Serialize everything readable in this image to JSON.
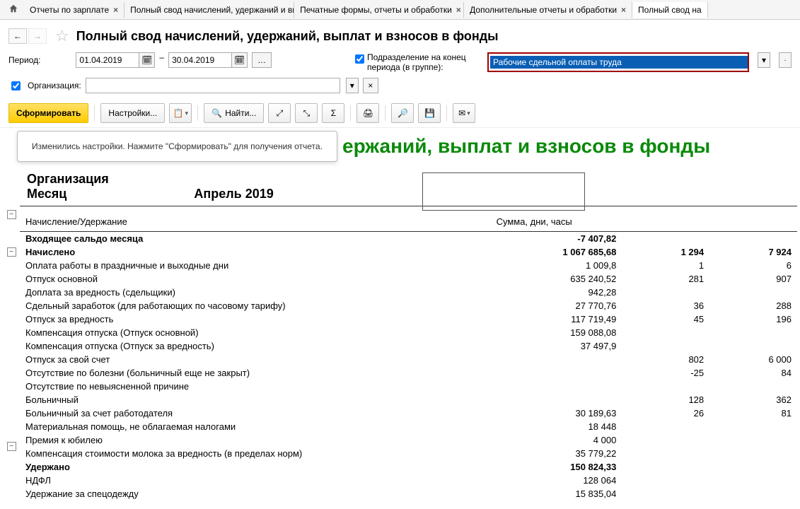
{
  "tabs": [
    {
      "label": "Отчеты по зарплате"
    },
    {
      "label": "Полный свод начислений, удержаний и выплат"
    },
    {
      "label": "Печатные формы, отчеты и обработки"
    },
    {
      "label": "Дополнительные отчеты и обработки"
    },
    {
      "label": "Полный свод на"
    }
  ],
  "page_title": "Полный свод начислений, удержаний, выплат и взносов в фонды",
  "period": {
    "label": "Период:",
    "from": "01.04.2019",
    "to": "30.04.2019"
  },
  "subdivision": {
    "checkbox_label": "Подразделение на конец периода (в группе):",
    "value": "Рабочие сдельной оплаты труда"
  },
  "org": {
    "checkbox_label": "Организация:",
    "value": ""
  },
  "toolbar": {
    "generate": "Сформировать",
    "settings": "Настройки...",
    "find": "Найти..."
  },
  "tooltip": "Изменились настройки. Нажмите \"Сформировать\" для получения отчета.",
  "report": {
    "title_suffix": "ержаний, выплат и взносов в фонды",
    "header": {
      "org_label": "Организация",
      "month_label": "Месяц",
      "month_value": "Апрель 2019"
    },
    "columns": {
      "name": "Начисление/Удержание",
      "sum": "Сумма, дни, часы"
    },
    "rows": [
      {
        "name": "Входящее сальдо месяца",
        "c1": "-7 407,82",
        "bold": true
      },
      {
        "name": "Начислено",
        "c1": "1 067 685,68",
        "c2": "1 294",
        "c3": "7 924",
        "bold": true
      },
      {
        "name": "Оплата работы в праздничные и выходные дни",
        "c1": "1 009,8",
        "c2": "1",
        "c3": "6"
      },
      {
        "name": "Отпуск основной",
        "c1": "635 240,52",
        "c2": "281",
        "c3": "907"
      },
      {
        "name": "Доплата за вредность (сдельщики)",
        "c1": "942,28"
      },
      {
        "name": "Сдельный заработок (для работающих по часовому тарифу)",
        "c1": "27 770,76",
        "c2": "36",
        "c3": "288"
      },
      {
        "name": "Отпуск за вредность",
        "c1": "117 719,49",
        "c2": "45",
        "c3": "196"
      },
      {
        "name": "Компенсация отпуска (Отпуск основной)",
        "c1": "159 088,08"
      },
      {
        "name": "Компенсация отпуска (Отпуск за вредность)",
        "c1": "37 497,9"
      },
      {
        "name": "Отпуск за свой счет",
        "c2": "802",
        "c3": "6 000"
      },
      {
        "name": "Отсутствие по болезни (больничный еще не закрыт)",
        "c2": "-25",
        "c3": "84"
      },
      {
        "name": "Отсутствие по невыясненной причине"
      },
      {
        "name": "Больничный",
        "c2": "128",
        "c3": "362"
      },
      {
        "name": "Больничный за счет работодателя",
        "c1": "30 189,63",
        "c2": "26",
        "c3": "81"
      },
      {
        "name": "Материальная помощь, не облагаемая налогами",
        "c1": "18 448"
      },
      {
        "name": "Премия к юбилею",
        "c1": "4 000"
      },
      {
        "name": "Компенсация стоимости молока за вредность (в пределах норм)",
        "c1": "35 779,22"
      },
      {
        "name": "Удержано",
        "c1": "150 824,33",
        "bold": true
      },
      {
        "name": "НДФЛ",
        "c1": "128 064"
      },
      {
        "name": "Удержание за спецодежду",
        "c1": "15 835,04"
      }
    ]
  }
}
